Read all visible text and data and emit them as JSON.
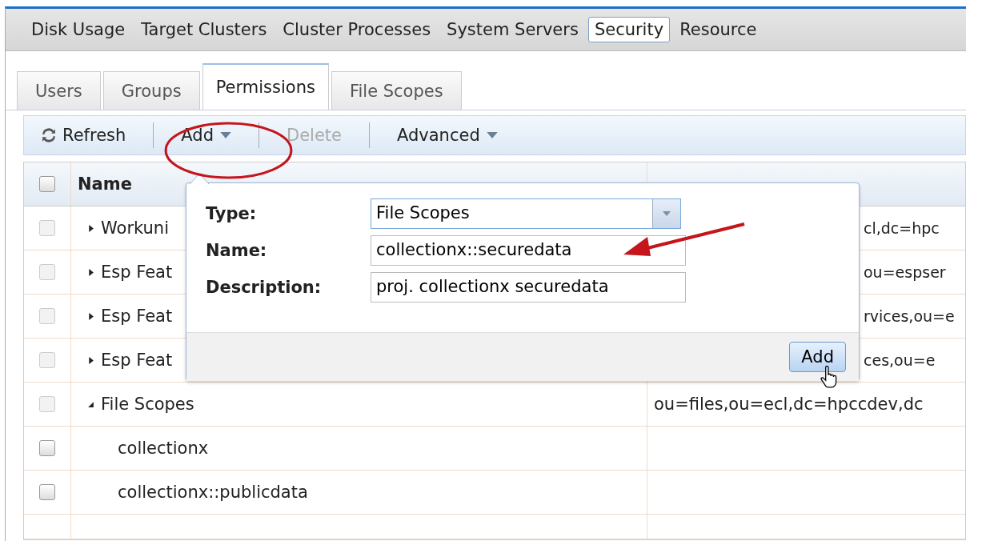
{
  "nav": [
    {
      "label": "Disk Usage",
      "selected": false
    },
    {
      "label": "Target Clusters",
      "selected": false
    },
    {
      "label": "Cluster Processes",
      "selected": false
    },
    {
      "label": "System Servers",
      "selected": false
    },
    {
      "label": "Security",
      "selected": true
    },
    {
      "label": "Resource",
      "selected": false
    }
  ],
  "tabs": [
    {
      "label": "Users",
      "selected": false
    },
    {
      "label": "Groups",
      "selected": false
    },
    {
      "label": "Permissions",
      "selected": true
    },
    {
      "label": "File Scopes",
      "selected": false
    }
  ],
  "toolbar": [
    {
      "kind": "refresh",
      "label": "Refresh",
      "disabled": false
    },
    {
      "kind": "dropdown",
      "label": "Add",
      "disabled": false
    },
    {
      "kind": "plain",
      "label": "Delete",
      "disabled": true
    },
    {
      "kind": "dropdown",
      "label": "Advanced",
      "disabled": false
    }
  ],
  "table": {
    "columns": [
      "Name"
    ],
    "select_all_checked": false,
    "rows": [
      {
        "name": "Workuni",
        "column_2": "cl,dc=hpc",
        "covered": true,
        "expanded": false,
        "checked": false
      },
      {
        "name": "Esp Feat",
        "column_2": "ou=espser",
        "covered": true,
        "expanded": false,
        "checked": false
      },
      {
        "name": "Esp Feat",
        "column_2": "rvices,ou=e",
        "covered": true,
        "expanded": false,
        "checked": false
      },
      {
        "name": "Esp Feat",
        "column_2": "ces,ou=e",
        "covered": true,
        "expanded": false,
        "checked": false
      },
      {
        "name": "File Scopes",
        "column_2": "ou=files,ou=ecl,dc=hpccdev,dc",
        "covered": false,
        "expanded": true,
        "checked": false,
        "children": [
          {
            "name": "collectionx",
            "checked": false
          },
          {
            "name": "collectionx::publicdata",
            "checked": false
          }
        ]
      }
    ]
  },
  "dialog": {
    "fields": [
      {
        "kind": "select",
        "label": "Type:",
        "value": "File Scopes"
      },
      {
        "kind": "text",
        "label": "Name:",
        "value": "collectionx::securedata"
      },
      {
        "kind": "text",
        "label": "Description:",
        "value": "proj. collectionx securedata"
      }
    ],
    "button": "Add"
  }
}
